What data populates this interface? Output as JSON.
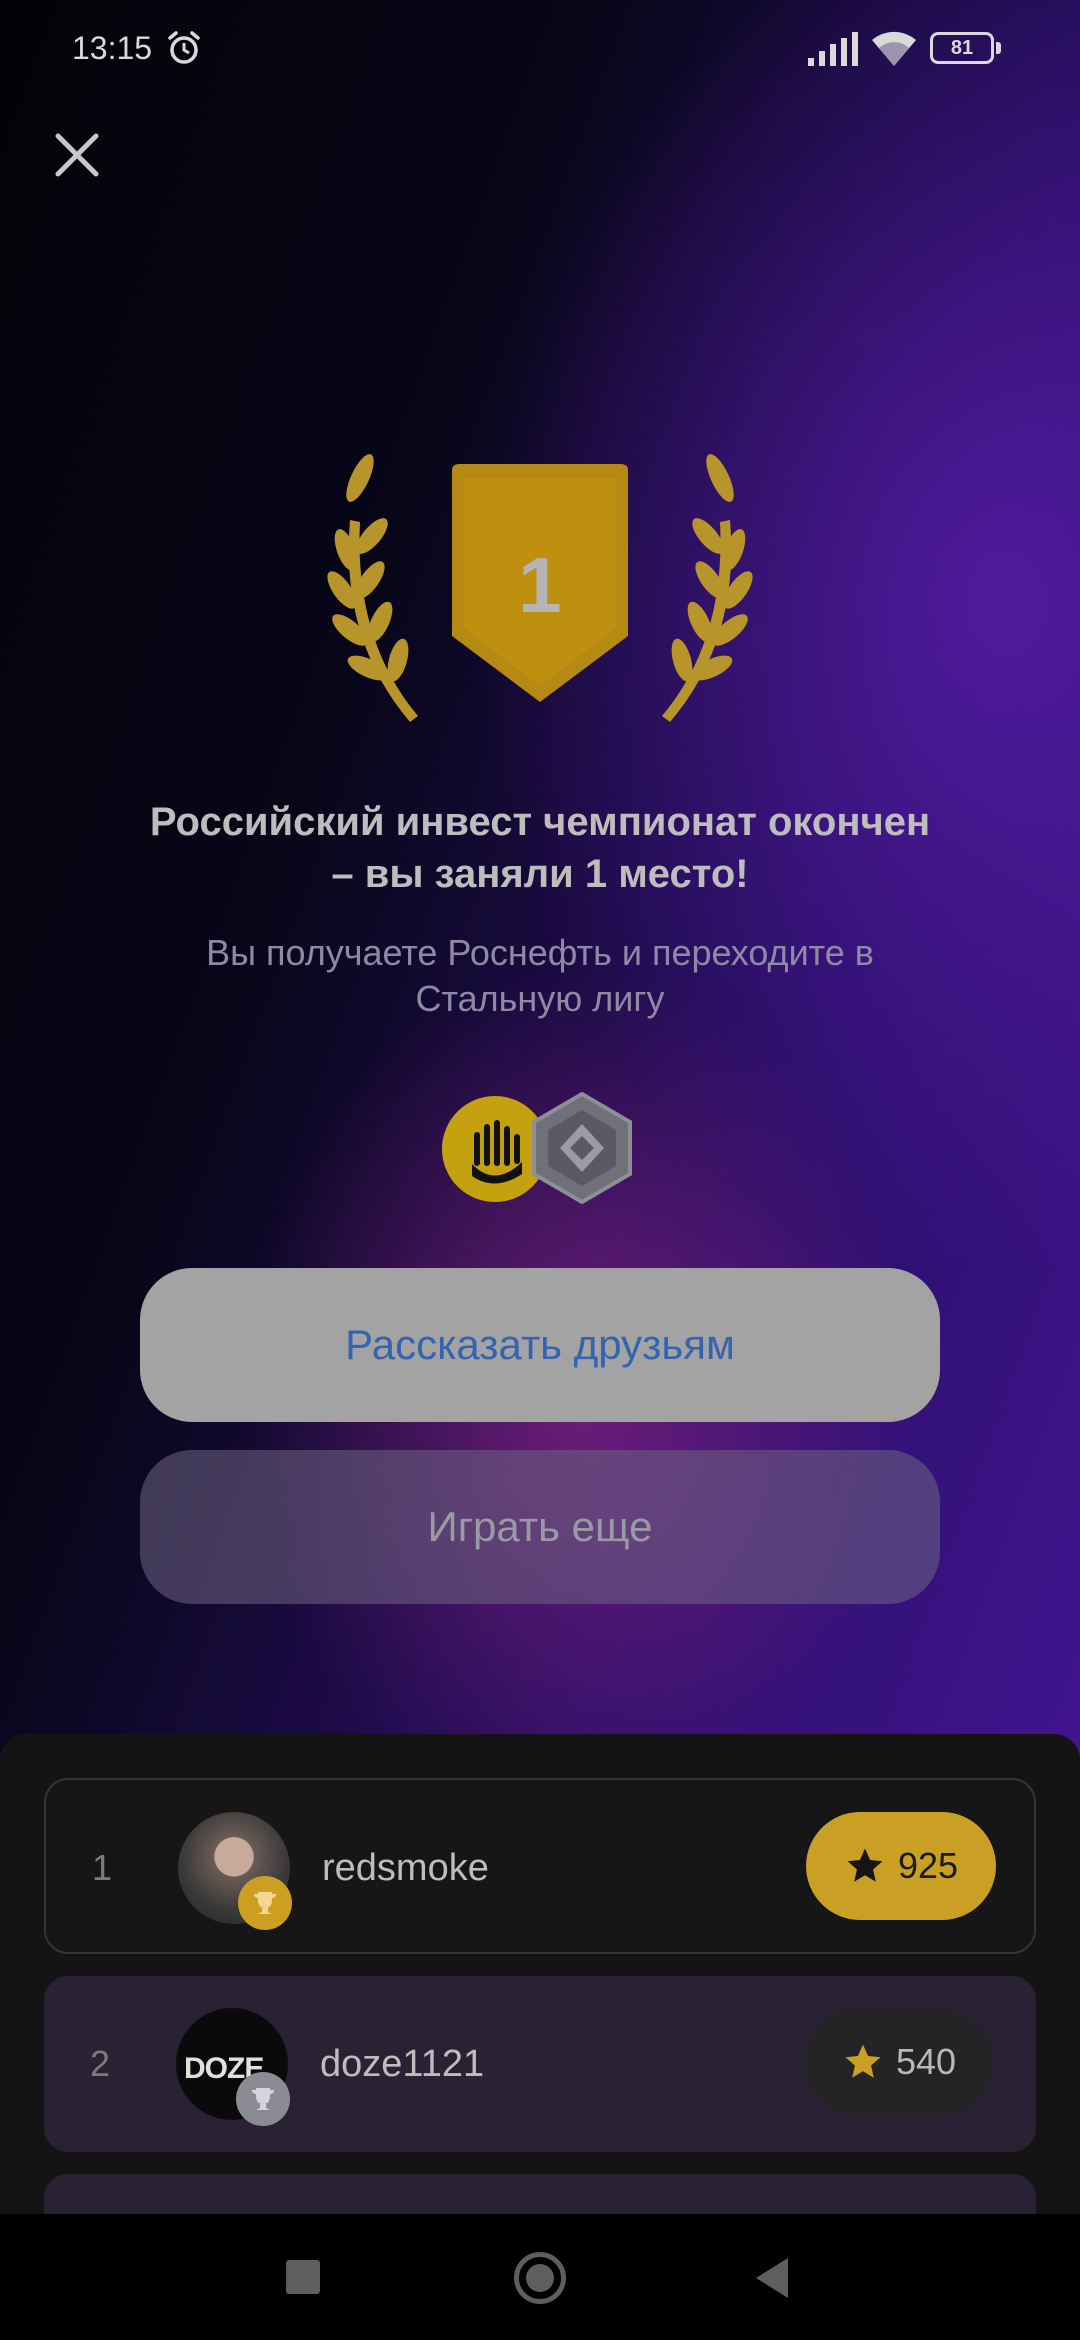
{
  "status_bar": {
    "time": "13:15",
    "battery": "81",
    "icons": [
      "alarm-icon",
      "signal-icon",
      "wifi-icon",
      "battery-icon"
    ]
  },
  "colors": {
    "accent_gold": "#c9a024",
    "share_text": "#3463b0",
    "background_purple": "#5a1ec8"
  },
  "result": {
    "place_badge": "1",
    "title": "Российский инвест чемпионат окончен – вы заняли 1 место!",
    "subtitle": "Вы получаете Роснефть и переходите в Стальную лигу",
    "reward_icons": [
      "rosneft-icon",
      "steel-league-icon"
    ]
  },
  "actions": {
    "share_label": "Рассказать друзьям",
    "play_label": "Играть еще"
  },
  "leaderboard": [
    {
      "rank": "1",
      "username": "redsmoke",
      "score": "925",
      "trophy": "gold"
    },
    {
      "rank": "2",
      "username": "doze1121",
      "score": "540",
      "trophy": "silver",
      "avatar_text": "DOZE"
    }
  ]
}
